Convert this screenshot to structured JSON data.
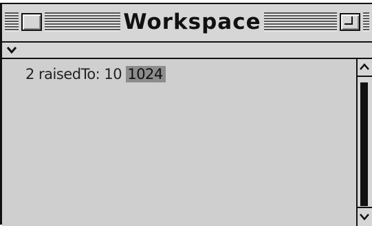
{
  "window": {
    "title": "Workspace"
  },
  "menu": {
    "icon": "chevron-down-icon"
  },
  "workspace": {
    "expression": "2 raisedTo: 10 ",
    "result": "1024"
  },
  "colors": {
    "window_bg": "#cfcfcf",
    "selection": "#8d8d8d",
    "frame": "#111111"
  },
  "icons": {
    "close_box": "close-box-icon",
    "zoom_box": "zoom-box-icon",
    "scroll_up": "arrow-up-icon",
    "scroll_down": "arrow-down-icon"
  }
}
